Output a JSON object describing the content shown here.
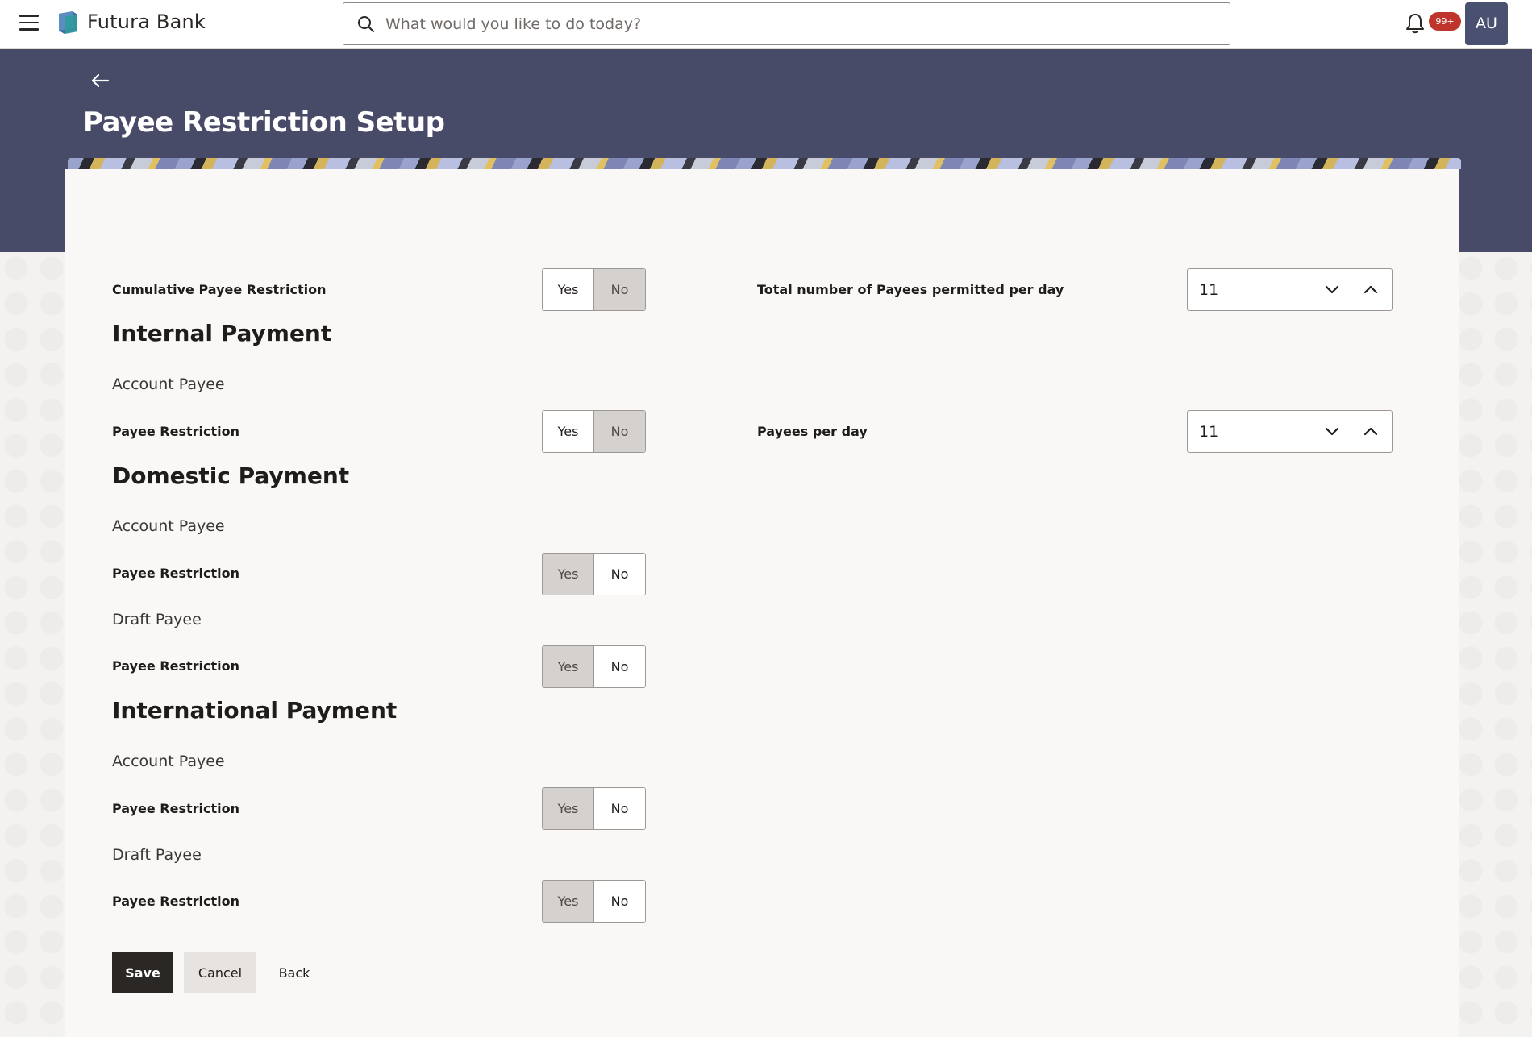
{
  "header": {
    "brand": "Futura Bank",
    "search_placeholder": "What would you like to do today?",
    "notification_badge": "99+",
    "avatar_initials": "AU"
  },
  "page": {
    "title": "Payee Restriction Setup"
  },
  "toggle_labels": {
    "yes": "Yes",
    "no": "No"
  },
  "cumulative": {
    "label": "Cumulative Payee Restriction",
    "selected": "No",
    "total_label": "Total number of Payees permitted per day",
    "total_value": "11"
  },
  "internal": {
    "title": "Internal Payment",
    "account_payee_label": "Account Payee",
    "restriction_label": "Payee Restriction",
    "restriction_selected": "No",
    "per_day_label": "Payees per day",
    "per_day_value": "11"
  },
  "domestic": {
    "title": "Domestic Payment",
    "account_payee_label": "Account Payee",
    "account_restriction_label": "Payee Restriction",
    "account_restriction_selected": "Yes",
    "draft_payee_label": "Draft Payee",
    "draft_restriction_label": "Payee Restriction",
    "draft_restriction_selected": "Yes"
  },
  "international": {
    "title": "International Payment",
    "account_payee_label": "Account Payee",
    "account_restriction_label": "Payee Restriction",
    "account_restriction_selected": "Yes",
    "draft_payee_label": "Draft Payee",
    "draft_restriction_label": "Payee Restriction",
    "draft_restriction_selected": "Yes"
  },
  "actions": {
    "save": "Save",
    "cancel": "Cancel",
    "back": "Back"
  },
  "icons": {
    "menu": "hamburger-menu-icon",
    "logo": "futura-bank-logo",
    "search": "search-icon",
    "bell": "bell-icon",
    "back": "arrow-left-icon",
    "down": "chevron-down-icon",
    "up": "chevron-up-icon"
  }
}
